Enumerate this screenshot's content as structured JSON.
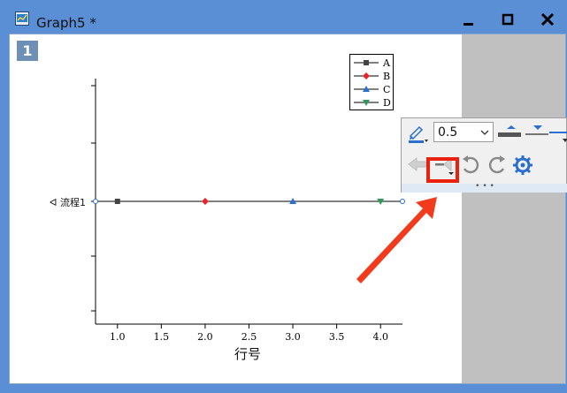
{
  "window": {
    "title": "Graph5 *",
    "layer_number": "1",
    "colors": {
      "titlebar": "#5a8fd6",
      "plot_bg": "#ffffff",
      "panel": "#c0c0c0",
      "highlight": "#e8220f"
    }
  },
  "chart_data": {
    "type": "line",
    "xlabel": "行号",
    "ylabel": "流程1",
    "xlim": [
      0.75,
      4.25
    ],
    "x_ticks": [
      "1.0",
      "1.5",
      "2.0",
      "2.5",
      "3.0",
      "3.5",
      "4.0"
    ],
    "x_tick_values": [
      1.0,
      1.5,
      2.0,
      2.5,
      3.0,
      3.5,
      4.0
    ],
    "y_category": "流程1",
    "series": [
      {
        "name": "A",
        "x": [
          1
        ],
        "color": "#444444",
        "marker": "square"
      },
      {
        "name": "B",
        "x": [
          2
        ],
        "color": "#e8232a",
        "marker": "diamond"
      },
      {
        "name": "C",
        "x": [
          3
        ],
        "color": "#2a6fd0",
        "marker": "triangle-up"
      },
      {
        "name": "D",
        "x": [
          4
        ],
        "color": "#2e9a5a",
        "marker": "triangle-down"
      }
    ],
    "legend_placement": "top-right",
    "grid": false
  },
  "toolbar": {
    "line_width": "0.5",
    "icons": [
      "pen-color-icon",
      "line-width-select",
      "line-thick-icon",
      "line-thin-icon",
      "arrow-left-icon",
      "arrow-right-icon",
      "rotate-left-icon",
      "rotate-right-icon",
      "settings-icon"
    ]
  }
}
